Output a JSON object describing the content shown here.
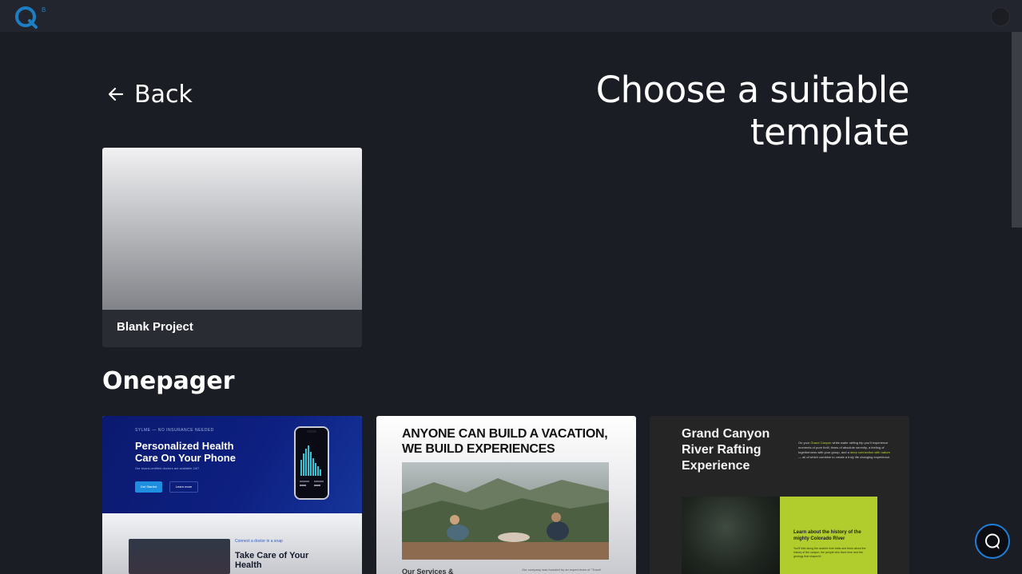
{
  "header": {
    "logo_letter": "Q",
    "logo_superscript": "B",
    "logo_icon": "brand-q-logo",
    "avatar_icon": "user-avatar-icon"
  },
  "nav": {
    "back_label": "Back",
    "back_icon": "arrow-left-icon"
  },
  "page": {
    "title": "Choose a suitable template"
  },
  "blank_project": {
    "label": "Blank Project"
  },
  "sections": [
    {
      "title": "Onepager",
      "templates": [
        {
          "kicker": "SYLME — NO INSURANCE NEEDED",
          "headline": "Personalized Health Care On Your Phone",
          "sub": "Our board-certified doctors are available 24/7",
          "cta_primary": "Get Started",
          "cta_secondary": "Learn more",
          "link": "Connect a doctor in a snap",
          "section_title": "Take Care of Your Health"
        },
        {
          "headline": "ANYONE CAN BUILD A VACATION, WE BUILD EXPERIENCES",
          "footer_heading": "Our Services &",
          "footer_text": "Our company was founded by an expert team of \"Travel"
        },
        {
          "headline": "Grand Canyon River Rafting Experience",
          "para_pre": "On your ",
          "para_hl1": "Grand Canyon",
          "para_mid": " white water rafting trip you'll experience moments of pure thrill, times of absolute serenity, a feeling of togetherness with your group, and a ",
          "para_hl2": "deep connection with nature",
          "para_post": " — all of which combine to create a truly life changing experience.",
          "green_heading": "Learn about the history of the mighty Colorado River",
          "green_text": "You'll hike along the ancient river trails and learn about the history of the canyon, the people who lived here and the geology that shaped it."
        }
      ]
    }
  ],
  "chat": {
    "icon": "chat-bubble-icon"
  },
  "colors": {
    "background": "#1b1d25",
    "topbar": "#22252d",
    "accent": "#1f7fd8",
    "scrollbar_thumb": "#3b3e45"
  }
}
